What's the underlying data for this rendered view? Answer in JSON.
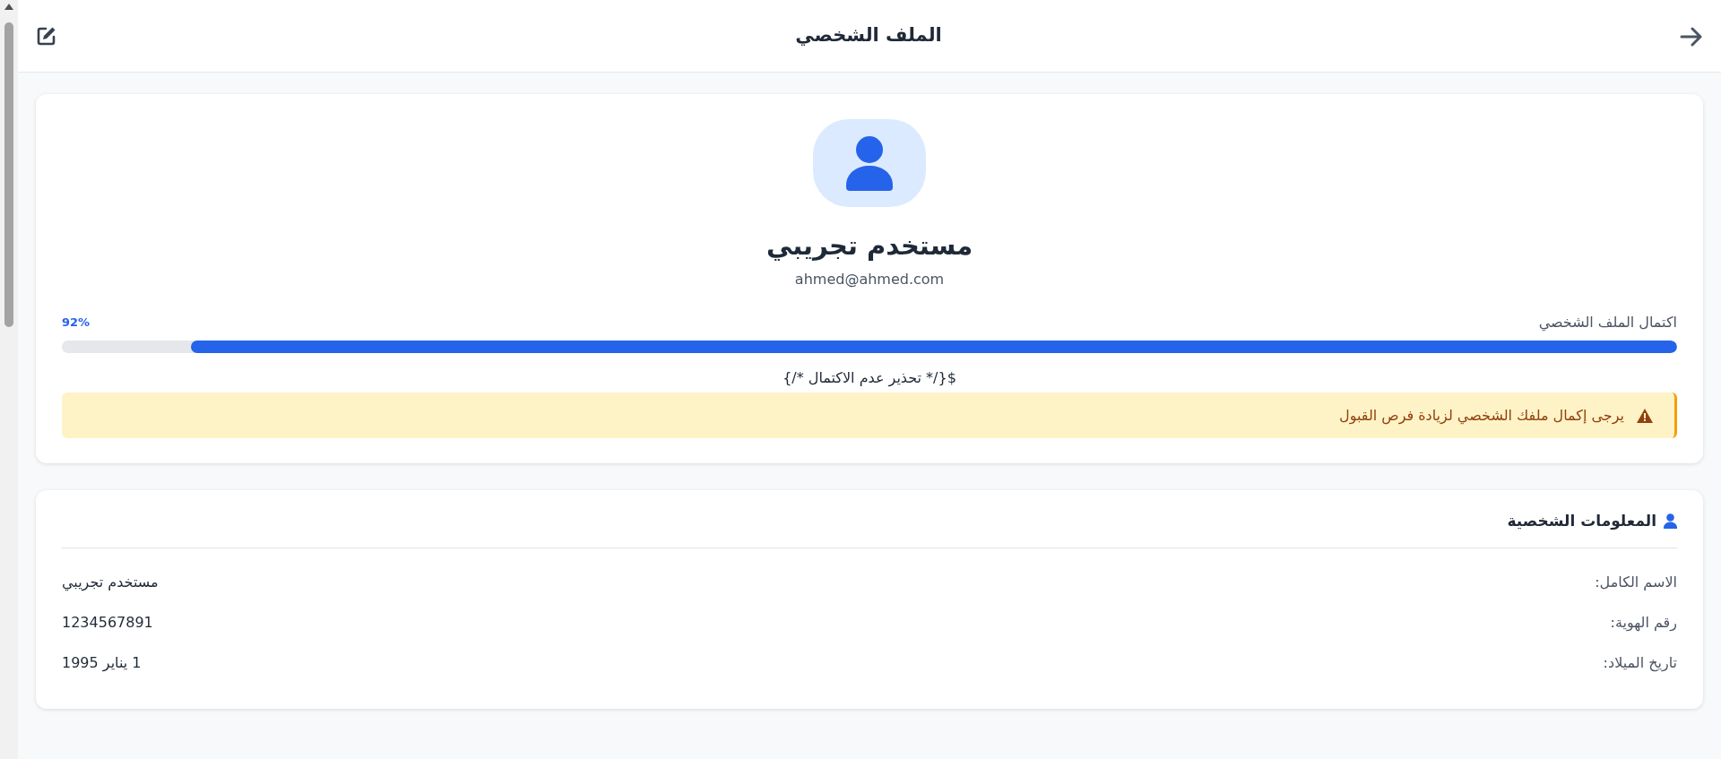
{
  "header": {
    "title": "الملف الشخصي"
  },
  "profile": {
    "name": "مستخدم تجريبي",
    "email": "ahmed@ahmed.com"
  },
  "completion": {
    "label": "اكتمال الملف الشخصي",
    "reading": "92%",
    "level": 0.92
  },
  "warning_comment": "${/* تحذير عدم الاكتمال */}",
  "alert": {
    "text": "يرجى إكمال ملفك الشخصي لزيادة فرص القبول"
  },
  "personal_info": {
    "title": "المعلومات الشخصية",
    "rows": [
      {
        "label": "الاسم الكامل:",
        "value": "مستخدم تجريبي"
      },
      {
        "label": "رقم الهوية:",
        "value": "1234567891"
      },
      {
        "label": "تاريخ الميلاد:",
        "value": "1 يناير 1995"
      }
    ]
  }
}
